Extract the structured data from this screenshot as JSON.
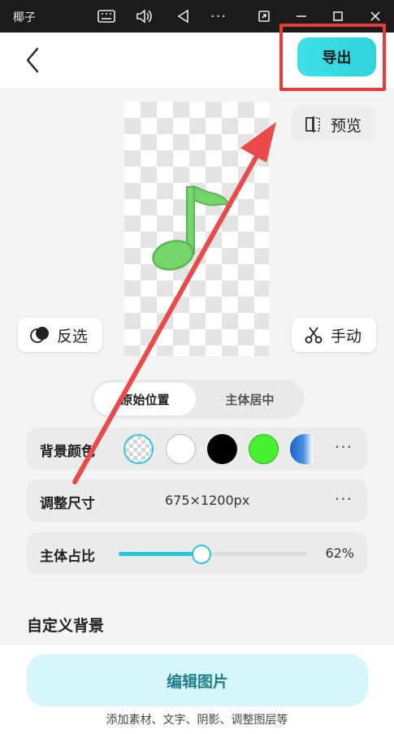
{
  "window": {
    "title": "椰子",
    "icons": [
      "keyboard-icon",
      "volume-icon",
      "back-triangle-icon",
      "more-dots-icon",
      "screen-rotate-icon",
      "minimize-icon",
      "maximize-icon",
      "close-icon"
    ]
  },
  "header": {
    "export_label": "导出",
    "accent_color": "#3ee0e6",
    "highlight_color": "#ea3b3b"
  },
  "canvas": {
    "preview_label": "预览",
    "invert_label": "反选",
    "manual_label": "手动"
  },
  "position_toggle": {
    "options": [
      "原始位置",
      "主体居中"
    ],
    "selected": "原始位置"
  },
  "background_color": {
    "label": "背景颜色",
    "swatches": [
      "transparent",
      "#ffffff",
      "#000000",
      "#46f230",
      "#1a63c7"
    ],
    "selected": "transparent"
  },
  "resize": {
    "label": "调整尺寸",
    "value": "675×1200px"
  },
  "subject_ratio": {
    "label": "主体占比",
    "value_text": "62%",
    "fraction": 0.44
  },
  "custom_background": {
    "title": "自定义背景"
  },
  "footer": {
    "edit_label": "编辑图片",
    "hint": "添加素材、文字、阴影、调整图层等"
  }
}
